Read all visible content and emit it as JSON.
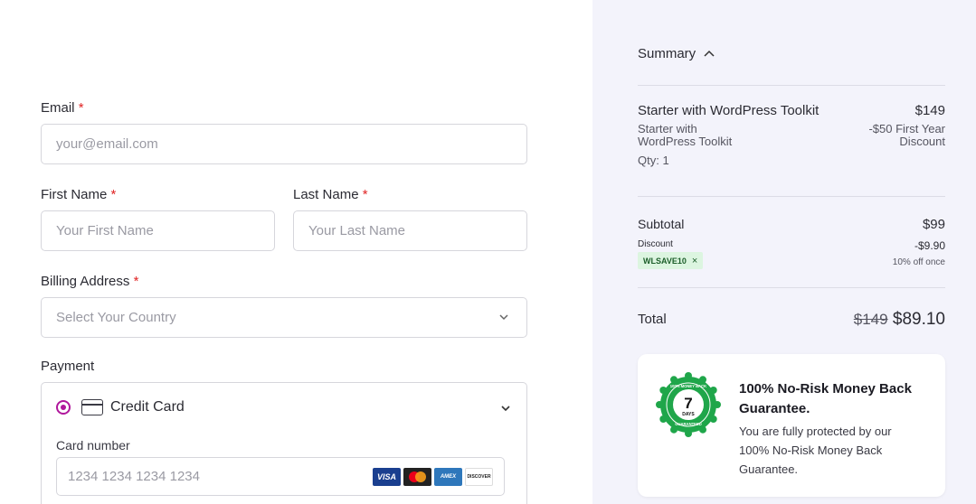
{
  "form": {
    "email": {
      "label": "Email",
      "required_mark": "*",
      "placeholder": "your@email.com"
    },
    "first_name": {
      "label": "First Name",
      "required_mark": "*",
      "placeholder": "Your First Name"
    },
    "last_name": {
      "label": "Last Name",
      "required_mark": "*",
      "placeholder": "Your Last Name"
    },
    "billing": {
      "label": "Billing Address",
      "required_mark": "*",
      "placeholder": "Select Your Country"
    },
    "payment": {
      "label": "Payment",
      "method": "Credit Card",
      "card_number_label": "Card number",
      "card_number_placeholder": "1234 1234 1234 1234",
      "brands": [
        "VISA",
        "mastercard",
        "AMEX",
        "DISCOVER"
      ]
    }
  },
  "summary": {
    "title": "Summary",
    "item": {
      "name": "Starter with WordPress Toolkit",
      "price": "$149",
      "sub_line1": "Starter with",
      "sub_line2": "WordPress Toolkit",
      "discount_line1": "-$50 First Year",
      "discount_line2": "Discount",
      "qty": "Qty: 1"
    },
    "subtotal_label": "Subtotal",
    "subtotal_value": "$99",
    "discount_label": "Discount",
    "discount_value": "-$9.90",
    "coupon_code": "WLSAVE10",
    "coupon_note": "10% off once",
    "total_label": "Total",
    "total_original": "$149",
    "total_value": "$89.10"
  },
  "guarantee": {
    "title": "100% No-Risk Money Back Guarantee.",
    "description": "You are fully protected by our 100% No-Risk Money Back Guarantee.",
    "badge_number": "7",
    "badge_unit": "DAYS",
    "badge_ring_top": "100% MONEY BACK",
    "badge_ring_bottom": "GUARANTEED"
  },
  "colors": {
    "accent": "#b0179c",
    "panel_bg": "#f3f3fb",
    "badge_green": "#1fa64a"
  }
}
